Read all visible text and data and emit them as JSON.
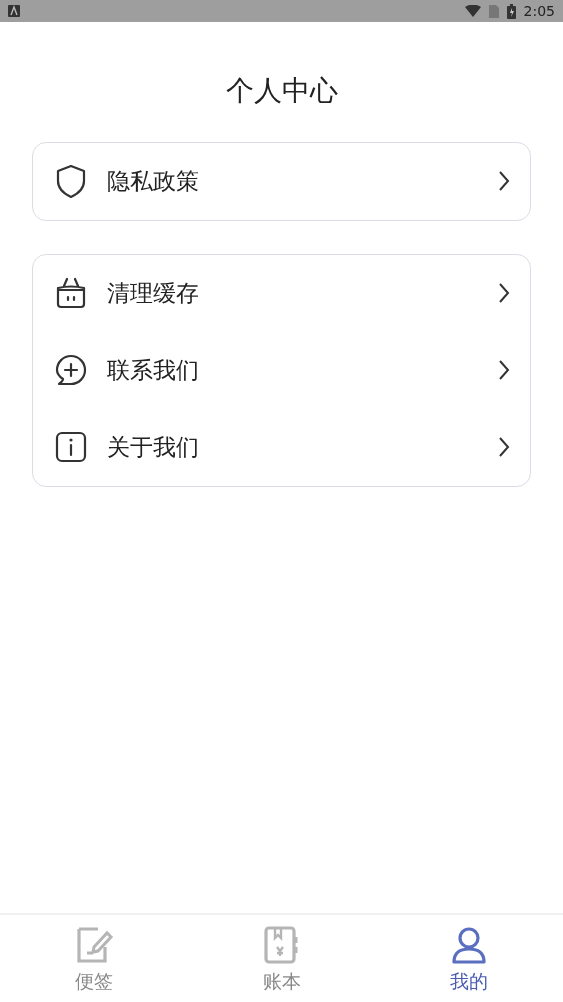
{
  "status_bar": {
    "time": "2:05"
  },
  "header": {
    "title": "个人中心"
  },
  "groups": [
    {
      "items": [
        {
          "kind": "shield",
          "label": "隐私政策"
        }
      ]
    },
    {
      "items": [
        {
          "kind": "basket",
          "label": "清理缓存"
        },
        {
          "kind": "chat",
          "label": "联系我们"
        },
        {
          "kind": "info",
          "label": "关于我们"
        }
      ]
    }
  ],
  "tabs": [
    {
      "kind": "note",
      "label": "便签",
      "selected": false
    },
    {
      "kind": "ledger",
      "label": "账本",
      "selected": false
    },
    {
      "kind": "person",
      "label": "我的",
      "selected": true
    }
  ]
}
